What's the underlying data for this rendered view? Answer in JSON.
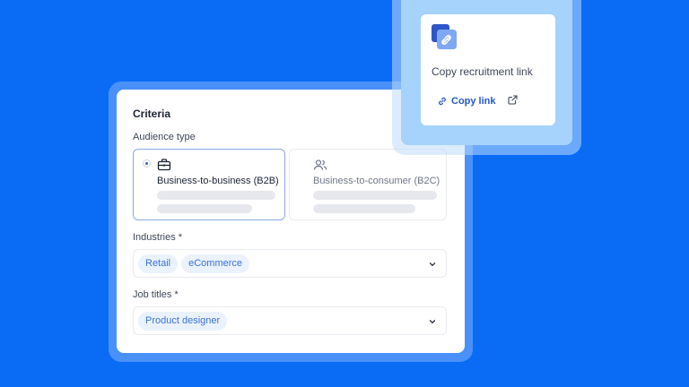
{
  "criteria": {
    "title": "Criteria",
    "audience_label": "Audience type",
    "options": [
      {
        "label": "Business-to-business (B2B)",
        "icon": "briefcase-icon",
        "selected": true
      },
      {
        "label": "Business-to-consumer (B2C)",
        "icon": "users-icon",
        "selected": false
      }
    ],
    "industries": {
      "label": "Industries *",
      "chips": [
        "Retail",
        "eCommerce"
      ]
    },
    "job_titles": {
      "label": "Job titles *",
      "chips": [
        "Product designer"
      ]
    }
  },
  "link_card": {
    "logo_icon": "link-logo-icon",
    "title": "Copy recruitment link",
    "copy_label": "Copy link"
  },
  "colors": {
    "background": "#0a6cf5",
    "accent": "#2458c8",
    "chip_bg": "#eaf2fd",
    "chip_text": "#3a73d9"
  }
}
